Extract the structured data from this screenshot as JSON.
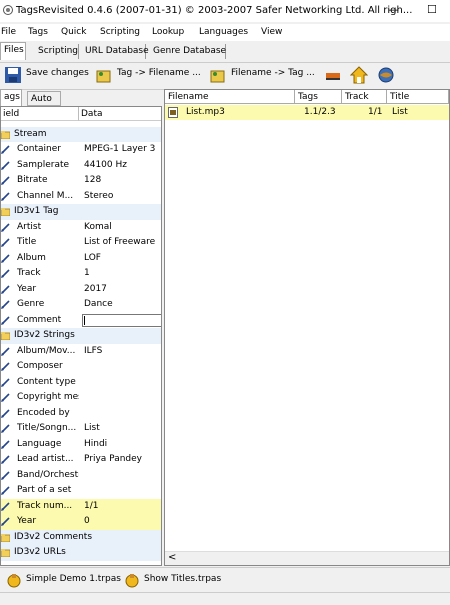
{
  "window": {
    "title": "TagsRevisited 0.4.6 (2007-01-31) © 2003-2007 Safer Networking Ltd. All righ...",
    "minimize": "—",
    "maximize": "☐"
  },
  "menu": [
    "File",
    "Tags",
    "Quick",
    "Scripting",
    "Lookup",
    "Languages",
    "View"
  ],
  "main_tabs": [
    "Files",
    "Scripting",
    "URL Database",
    "Genre Database"
  ],
  "toolbar": {
    "save": "Save changes",
    "tag_to_filename": "Tag -> Filename ...",
    "filename_to_tag": "Filename -> Tag ..."
  },
  "left_tabs": [
    "ags",
    "Auto"
  ],
  "tag_table": {
    "headers": [
      "ield",
      "Data"
    ],
    "rows": [
      {
        "type": "group",
        "name": "Stream"
      },
      {
        "type": "field",
        "name": "Container",
        "value": "MPEG-1 Layer 3"
      },
      {
        "type": "field",
        "name": "Samplerate",
        "value": "44100 Hz"
      },
      {
        "type": "field",
        "name": "Bitrate",
        "value": "128"
      },
      {
        "type": "field",
        "name": "Channel M...",
        "value": "Stereo"
      },
      {
        "type": "group",
        "name": "ID3v1 Tag"
      },
      {
        "type": "field",
        "name": "Artist",
        "value": "Komal"
      },
      {
        "type": "field",
        "name": "Title",
        "value": "List of Freeware"
      },
      {
        "type": "field",
        "name": "Album",
        "value": "LOF"
      },
      {
        "type": "field",
        "name": "Track",
        "value": "1"
      },
      {
        "type": "field",
        "name": "Year",
        "value": "2017"
      },
      {
        "type": "field",
        "name": "Genre",
        "value": "Dance"
      },
      {
        "type": "edit",
        "name": "Comment",
        "value": ""
      },
      {
        "type": "group",
        "name": "ID3v2 Strings"
      },
      {
        "type": "field",
        "name": "Album/Mov...",
        "value": "ILFS"
      },
      {
        "type": "field",
        "name": "Composer",
        "value": ""
      },
      {
        "type": "field",
        "name": "Content type",
        "value": ""
      },
      {
        "type": "field",
        "name": "Copyright message",
        "value": ""
      },
      {
        "type": "field",
        "name": "Encoded by",
        "value": ""
      },
      {
        "type": "field",
        "name": "Title/Songn...",
        "value": "List"
      },
      {
        "type": "field",
        "name": "Language",
        "value": "Hindi"
      },
      {
        "type": "field",
        "name": "Lead artist...",
        "value": "Priya Pandey"
      },
      {
        "type": "field",
        "name": "Band/Orchestra/Accompaniment",
        "value": ""
      },
      {
        "type": "field",
        "name": "Part of a set",
        "value": ""
      },
      {
        "type": "hl",
        "name": "Track num...",
        "value": "1/1"
      },
      {
        "type": "hl",
        "name": "Year",
        "value": "0"
      },
      {
        "type": "group",
        "name": "ID3v2 Comments"
      },
      {
        "type": "group",
        "name": "ID3v2 URLs"
      }
    ]
  },
  "file_table": {
    "headers": [
      "Filename",
      "Tags",
      "Track",
      "Title"
    ],
    "rows": [
      {
        "filename": "List.mp3",
        "tags": "1.1/2.3",
        "track": "1/1",
        "title": "List"
      }
    ]
  },
  "scroll_left": "<",
  "bottom": [
    "Simple Demo 1.trpas",
    "Show Titles.trpas"
  ]
}
